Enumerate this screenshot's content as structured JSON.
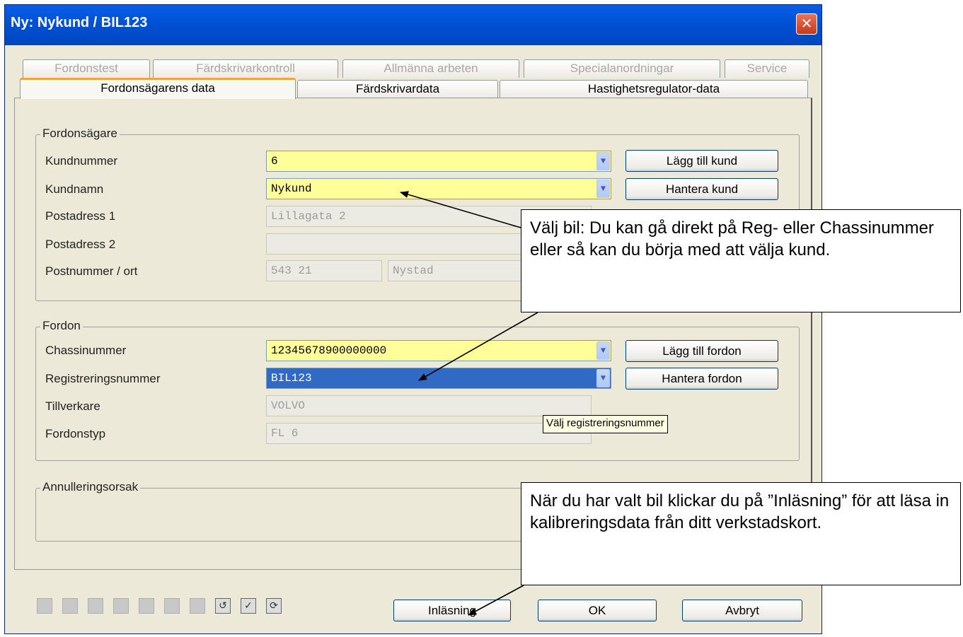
{
  "window": {
    "title": "Ny: Nykund / BIL123",
    "close_glyph": "✕"
  },
  "tabs_back": [
    {
      "label": "Fordonstest"
    },
    {
      "label": "Färdskrivarkontroll"
    },
    {
      "label": "Allmänna arbeten"
    },
    {
      "label": "Specialanordningar"
    },
    {
      "label": "Service"
    }
  ],
  "tabs_front": [
    {
      "label": "Fordonsägarens data",
      "active": true
    },
    {
      "label": "Färdskrivardata"
    },
    {
      "label": "Hastighetsregulator-data"
    }
  ],
  "owner": {
    "group_title": "Fordonsägare",
    "kundnummer_label": "Kundnummer",
    "kundnummer_value": "6",
    "kundnamn_label": "Kundnamn",
    "kundnamn_value": "Nykund",
    "postadress1_label": "Postadress 1",
    "postadress1_value": "Lillagata 2",
    "postadress2_label": "Postadress 2",
    "postadress2_value": "",
    "postnummer_label": "Postnummer / ort",
    "postnummer_value": "543 21",
    "ort_value": "Nystad",
    "add_customer_button": "Lägg till kund",
    "manage_customer_button": "Hantera kund"
  },
  "vehicle": {
    "group_title": "Fordon",
    "chassis_label": "Chassinummer",
    "chassis_value": "12345678900000000",
    "reg_label": "Registreringsnummer",
    "reg_value": "BIL123",
    "maker_label": "Tillverkare",
    "maker_value": "VOLVO",
    "type_label": "Fordonstyp",
    "type_value": "FL 6",
    "add_vehicle_button": "Lägg till fordon",
    "manage_vehicle_button": "Hantera fordon",
    "tooltip": "Välj registreringsnummer"
  },
  "cancellation": {
    "group_title": "Annulleringsorsak"
  },
  "footer": {
    "read_button": "Inläsning",
    "ok_button": "OK",
    "cancel_button": "Avbryt"
  },
  "callouts": {
    "choose_car": "Välj bil: Du kan gå direkt på Reg- eller Chassinummer eller så kan du börja med att välja kund.",
    "after_choose": "När du har valt bil klickar du på ”Inläsning” för att läsa in kalibreringsdata från ditt verkstadskort."
  },
  "icons": {
    "dropdown": "chevron-down-icon",
    "close": "close-icon"
  },
  "colors": {
    "titlebar": "#0052d6",
    "required_field": "#ffff99",
    "selection": "#316ac5",
    "active_tab_accent": "#f3a33b"
  }
}
